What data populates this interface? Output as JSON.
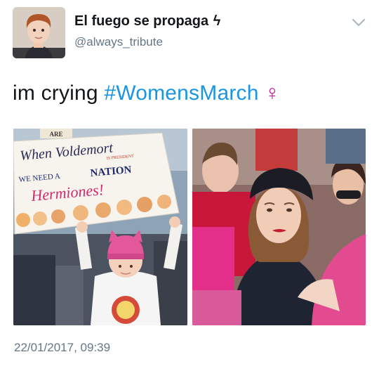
{
  "tweet": {
    "display_name": "El fuego se propaga",
    "name_glyph": "ϟ",
    "handle": "@always_tribute",
    "text_prefix": "im crying ",
    "hashtag": "#WomensMarch",
    "emoji": "♀",
    "timestamp": "22/01/2017, 09:39"
  },
  "photo_left": {
    "sign_top": "ARE",
    "sign_line1": "When Voldemort",
    "sign_insert": "IS PRESIDENT",
    "sign_line2a": "WE NEED A",
    "sign_line2b": "NATION",
    "sign_line3": "Hermiones!"
  },
  "icons": {
    "menu": "chevron-down-icon",
    "venus": "female-sign-icon"
  },
  "colors": {
    "hashtag": "#1b95e0",
    "emoji": "#c0179a",
    "secondary_text": "#657786"
  }
}
